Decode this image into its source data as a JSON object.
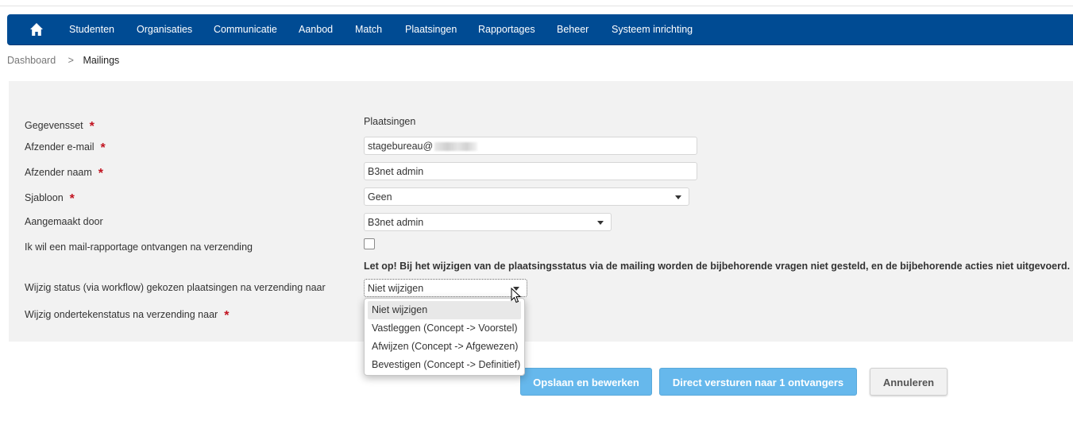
{
  "nav": {
    "home_icon": "home-icon",
    "items": [
      "Studenten",
      "Organisaties",
      "Communicatie",
      "Aanbod",
      "Match",
      "Plaatsingen",
      "Rapportages",
      "Beheer",
      "Systeem inrichting"
    ],
    "bg_color": "#004b93"
  },
  "breadcrumb": {
    "root": "Dashboard",
    "separator": ">",
    "current": "Mailings"
  },
  "form": {
    "gegevensset": {
      "label": "Gegevensset",
      "required": "*",
      "value": "Plaatsingen"
    },
    "afzender_email": {
      "label": "Afzender e-mail",
      "required": "*",
      "value": "stagebureau@"
    },
    "afzender_naam": {
      "label": "Afzender naam",
      "required": "*",
      "value": "B3net admin"
    },
    "sjabloon": {
      "label": "Sjabloon",
      "required": "*",
      "value": "Geen"
    },
    "aangemaakt_door": {
      "label": "Aangemaakt door",
      "value": "B3net admin"
    },
    "mail_rapportage": {
      "label": "Ik wil een mail-rapportage ontvangen na verzending",
      "checked": false
    },
    "warning": "Let op! Bij het wijzigen van de plaatsingsstatus via de mailing worden de bijbehorende vragen niet gesteld, en de bijbehorende acties niet uitgevoerd.",
    "wijzig_status": {
      "label": "Wijzig status (via workflow) gekozen plaatsingen na verzending naar",
      "value": "Niet wijzigen"
    },
    "wijzig_ondertekenstatus": {
      "label": "Wijzig ondertekenstatus na verzending naar",
      "required": "*"
    }
  },
  "dropdown": {
    "options": [
      "Niet wijzigen",
      "Vastleggen (Concept -> Voorstel)",
      "Afwijzen (Concept -> Afgewezen)",
      "Bevestigen (Concept -> Definitief)"
    ],
    "selected_index": 0
  },
  "buttons": {
    "save": "Opslaan en bewerken",
    "send": "Direct versturen naar 1 ontvangers",
    "cancel": "Annuleren"
  },
  "colors": {
    "primary_button": "#66b8ec",
    "required_marker": "#c1121f"
  }
}
